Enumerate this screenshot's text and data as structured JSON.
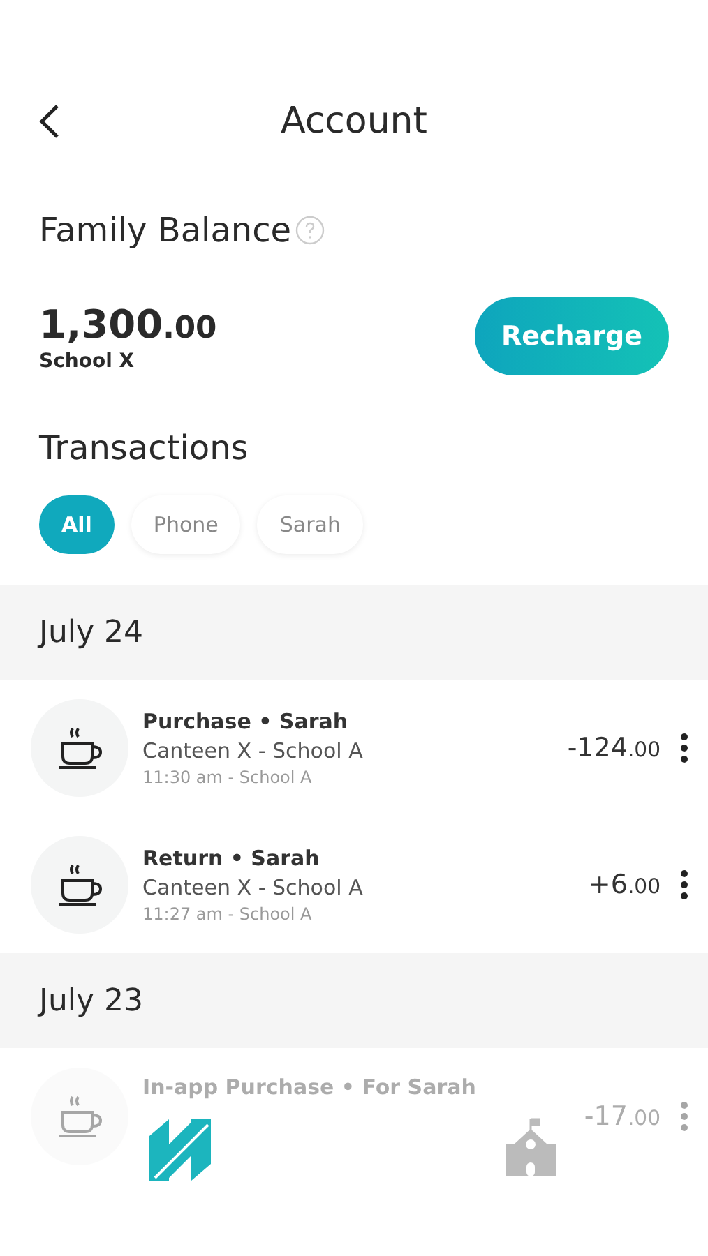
{
  "header": {
    "title": "Account"
  },
  "balance": {
    "title": "Family Balance",
    "amount": "1,300",
    "cents": ".00",
    "school": "School X",
    "button": "Recharge"
  },
  "transactions": {
    "title": "Transactions",
    "filters": [
      {
        "label": "All",
        "selected": true
      },
      {
        "label": "Phone",
        "selected": false
      },
      {
        "label": "Sarah",
        "selected": false
      }
    ],
    "groups": [
      {
        "date": "July 24",
        "items": [
          {
            "title": "Purchase • Sarah",
            "place": "Canteen X - School A",
            "time": "11:30 am - School A",
            "amount": "-124",
            "cents": ".00",
            "faded": false
          },
          {
            "title": "Return • Sarah",
            "place": "Canteen X - School A",
            "time": "11:27 am - School A",
            "amount": "+6",
            "cents": ".00",
            "faded": false
          }
        ]
      },
      {
        "date": "July 23",
        "items": [
          {
            "title": "In-app Purchase • For Sarah",
            "amount": "-17",
            "cents": ".00",
            "faded": true
          }
        ]
      }
    ]
  }
}
